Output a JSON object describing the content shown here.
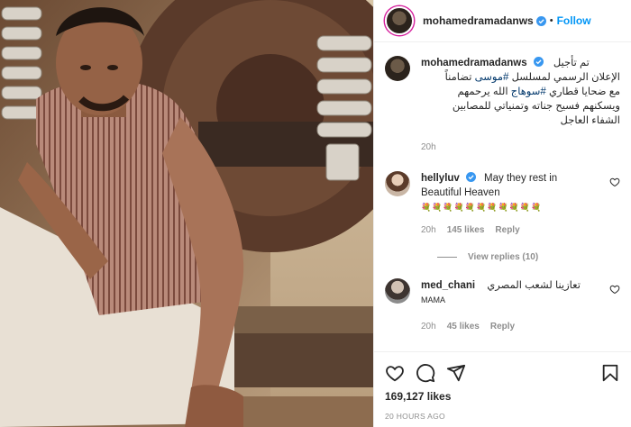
{
  "post": {
    "username": "mohamedramadanws",
    "follow_label": "Follow",
    "dot": "•"
  },
  "caption": {
    "username": "mohamedramadanws",
    "line1_prefix": "تم تأجيل",
    "line2_a": "الإعلان الرسمي لمسلسل",
    "line2_tag": "#موسى",
    "line2_b": "تضامناً",
    "line3_a": "مع ضحايا قطاري",
    "line3_tag": "#سوهاج",
    "line3_b": "الله يرحمهم",
    "line4": "ويسكنهم فسيح جناته وتمنياتي للمصابين",
    "line5": "الشفاء العاجل",
    "time": "20h"
  },
  "comments": [
    {
      "username": "hellyluv",
      "text_1": "May they rest in",
      "text_2": "Beautiful Heaven",
      "emoji_line": "💐💐💐💐💐💐💐💐💐💐💐",
      "time": "20h",
      "likes": "145 likes",
      "reply": "Reply",
      "view_replies": "View replies (10)"
    },
    {
      "username": "med_chani",
      "text": "تعازينا لشعب المصري",
      "text_2": "MAMA",
      "time": "20h",
      "likes": "45 likes",
      "reply": "Reply"
    }
  ],
  "actions": {
    "like_count": "169,127 likes",
    "timestamp": "20 HOURS AGO"
  },
  "colors": {
    "accent": "#0095f6",
    "verified": "#3897f0",
    "hashtag": "#00376b",
    "muted": "#8e8e8e"
  }
}
